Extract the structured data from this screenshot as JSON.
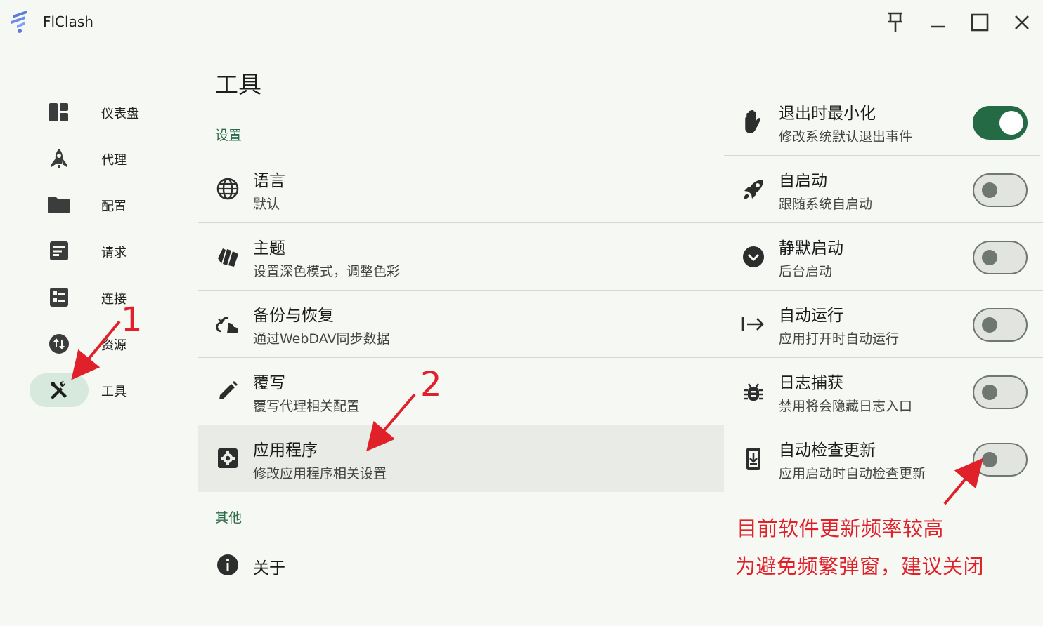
{
  "app": {
    "title": "FlClash"
  },
  "window_controls": [
    {
      "name": "pin-icon"
    },
    {
      "name": "minimize-icon"
    },
    {
      "name": "maximize-icon"
    },
    {
      "name": "close-icon"
    }
  ],
  "sidebar": {
    "items": [
      {
        "label": "仪表盘",
        "icon": "dashboard-icon"
      },
      {
        "label": "代理",
        "icon": "rocket-icon"
      },
      {
        "label": "配置",
        "icon": "folder-icon"
      },
      {
        "label": "请求",
        "icon": "list-box-icon"
      },
      {
        "label": "连接",
        "icon": "grid-list-icon"
      },
      {
        "label": "资源",
        "icon": "swap-vertical-icon"
      },
      {
        "label": "工具",
        "icon": "tools-icon",
        "active": true
      }
    ]
  },
  "main": {
    "title": "工具",
    "sections": {
      "settings": "设置",
      "other": "其他"
    },
    "left_items": [
      {
        "title": "语言",
        "subtitle": "默认",
        "icon": "globe-icon"
      },
      {
        "title": "主题",
        "subtitle": "设置深色模式，调整色彩",
        "icon": "palette-cards-icon"
      },
      {
        "title": "备份与恢复",
        "subtitle": "通过WebDAV同步数据",
        "icon": "cloud-sync-icon"
      },
      {
        "title": "覆写",
        "subtitle": "覆写代理相关配置",
        "icon": "pencil-icon"
      },
      {
        "title": "应用程序",
        "subtitle": "修改应用程序相关设置",
        "icon": "settings-box-icon",
        "selected": true
      }
    ],
    "about": {
      "title": "关于",
      "icon": "info-icon"
    },
    "right_items": [
      {
        "title": "退出时最小化",
        "subtitle": "修改系统默认退出事件",
        "icon": "hand-icon",
        "enabled": true
      },
      {
        "title": "自启动",
        "subtitle": "跟随系统自启动",
        "icon": "rocket-launch-icon",
        "enabled": false
      },
      {
        "title": "静默启动",
        "subtitle": "后台启动",
        "icon": "chevron-circle-down-icon",
        "enabled": false
      },
      {
        "title": "自动运行",
        "subtitle": "应用打开时自动运行",
        "icon": "arrow-right-to-bar-icon",
        "enabled": false
      },
      {
        "title": "日志捕获",
        "subtitle": "禁用将会隐藏日志入口",
        "icon": "bug-icon",
        "enabled": false
      },
      {
        "title": "自动检查更新",
        "subtitle": "应用启动时自动检查更新",
        "icon": "download-phone-icon",
        "enabled": false
      }
    ]
  },
  "annotations": {
    "step1": "1",
    "step2": "2",
    "note_line1": "目前软件更新频率较高",
    "note_line2": "为避免频繁弹窗，建议关闭",
    "color": "#e0212a"
  },
  "colors": {
    "accent": "#236a45",
    "section": "#2c6b48",
    "active_nav": "#d7e8dc",
    "background": "#f6f8f4"
  }
}
